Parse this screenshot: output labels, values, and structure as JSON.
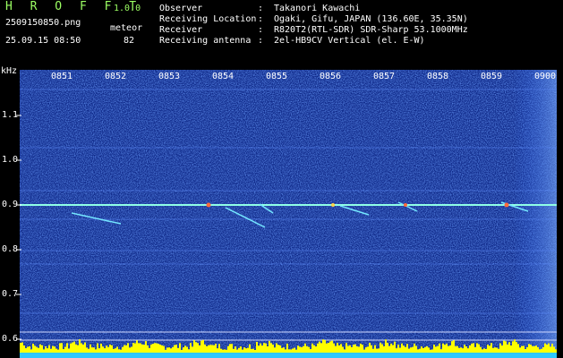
{
  "app": {
    "title": "H R O F F T",
    "version": "1.0.0",
    "filename": "2509150850.png",
    "meteor_label": "meteor",
    "datetime": "25.09.15 08:50",
    "meteor_count": "82"
  },
  "info": [
    {
      "key": "Observer",
      "value": "Takanori Kawachi"
    },
    {
      "key": "Receiving Location",
      "value": "Ogaki, Gifu, JAPAN (136.60E, 35.35N)"
    },
    {
      "key": "Receiver",
      "value": "R820T2(RTL-SDR) SDR-Sharp 53.1000MHz"
    },
    {
      "key": "Receiving antenna",
      "value": "2el-HB9CV Vertical (el. E-W)"
    }
  ],
  "axis": {
    "y_unit": "kHz",
    "y_ticks": [
      "1.1",
      "1.0",
      "0.9",
      "0.8",
      "0.7",
      "0.6"
    ],
    "x_ticks": [
      "0851",
      "0852",
      "0853",
      "0854",
      "0855",
      "0856",
      "0857",
      "0858",
      "0859",
      "0900"
    ]
  },
  "colors": {
    "background": "#000000",
    "spectrum_base": "#102a8a",
    "carrier": "#8fffe6",
    "signal_bar": "#ffff00",
    "header_green": "#9cff63"
  }
}
